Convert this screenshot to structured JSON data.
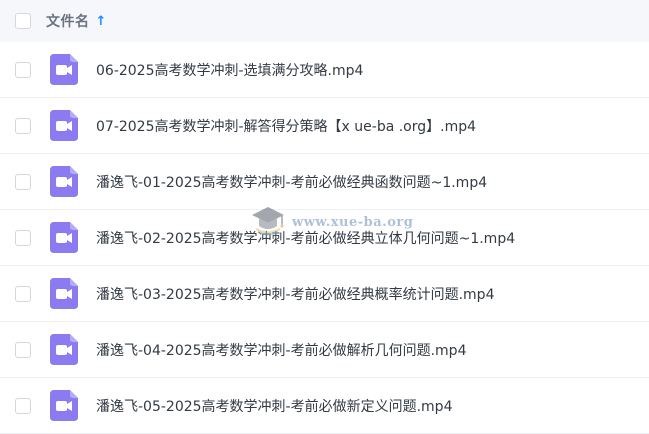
{
  "header": {
    "title": "文件名",
    "sort_icon": "arrow-up-icon",
    "sort_glyph": "↑"
  },
  "files": [
    {
      "name": "06-2025高考数学冲刺-选填满分攻略.mp4",
      "icon": "video-file-icon"
    },
    {
      "name": "07-2025高考数学冲刺-解答得分策略【x ue-ba .org】.mp4",
      "icon": "video-file-icon"
    },
    {
      "name": "潘逸飞-01-2025高考数学冲刺-考前必做经典函数问题~1.mp4",
      "icon": "video-file-icon"
    },
    {
      "name": "潘逸飞-02-2025高考数学冲刺-考前必做经典立体几何问题~1.mp4",
      "icon": "video-file-icon"
    },
    {
      "name": "潘逸飞-03-2025高考数学冲刺-考前必做经典概率统计问题.mp4",
      "icon": "video-file-icon"
    },
    {
      "name": "潘逸飞-04-2025高考数学冲刺-考前必做解析几何问题.mp4",
      "icon": "video-file-icon"
    },
    {
      "name": "潘逸飞-05-2025高考数学冲刺-考前必做新定义问题.mp4",
      "icon": "video-file-icon"
    }
  ],
  "watermark": {
    "text": "www.xue-ba.org",
    "icon": "graduation-cap-icon"
  },
  "colors": {
    "accent": "#1f8bff",
    "video_icon": "#8a7cf0",
    "header_bg": "#f5f7fb",
    "text": "#333a44"
  }
}
